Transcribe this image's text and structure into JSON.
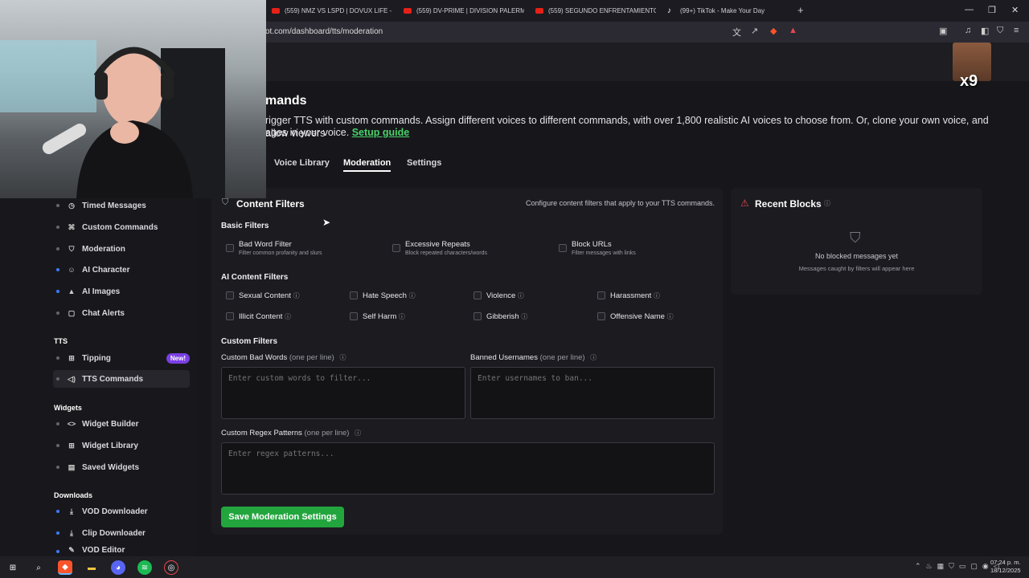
{
  "browser": {
    "tabs": [
      {
        "label": "(559) NMZ VS LSPD | DOVUX LIFE - Y",
        "kind": "youtube"
      },
      {
        "label": "(559) DV-PRIME | DIVISION PALERMO",
        "kind": "youtube"
      },
      {
        "label": "(559) SEGUNDO ENFRENTAMIENTO",
        "kind": "youtube"
      },
      {
        "label": "(99+) TikTok - Make Your Day",
        "kind": "tiktok"
      }
    ],
    "url": "ot.com/dashboard/tts/moderation"
  },
  "header": {
    "title": "mands",
    "description_line1": "rigger TTS with custom commands. Assign different voices to different commands, with over 1,800 realistic AI voices to choose from. Or, clone your own voice, and allow viewers",
    "description_line2": "ages in your voice.",
    "setup_guide": "Setup guide"
  },
  "page_tabs": [
    "Voice Library",
    "Moderation",
    "Settings"
  ],
  "sidebar": {
    "top_items": [
      {
        "label": "Timed Messages",
        "icon": "clock-icon",
        "dot": "gray"
      },
      {
        "label": "Custom Commands",
        "icon": "command-icon",
        "dot": "gray"
      },
      {
        "label": "Moderation",
        "icon": "shield-icon",
        "dot": "gray"
      },
      {
        "label": "AI Character",
        "icon": "user-icon",
        "dot": "blue"
      },
      {
        "label": "AI Images",
        "icon": "image-icon",
        "dot": "blue"
      },
      {
        "label": "Chat Alerts",
        "icon": "bell-icon",
        "dot": "gray"
      }
    ],
    "tts_section": "TTS",
    "tts_items": [
      {
        "label": "Tipping",
        "badge": "New!"
      },
      {
        "label": "TTS Commands"
      }
    ],
    "widgets_section": "Widgets",
    "widgets_items": [
      "Widget Builder",
      "Widget Library",
      "Saved Widgets"
    ],
    "downloads_section": "Downloads",
    "downloads_items": [
      "VOD Downloader",
      "Clip Downloader",
      "VOD Editor"
    ]
  },
  "content_filters": {
    "title": "Content Filters",
    "description": "Configure content filters that apply to your TTS commands.",
    "basic_title": "Basic Filters",
    "basic": [
      {
        "label": "Bad Word Filter",
        "hint": "Filter common profanity and slurs"
      },
      {
        "label": "Excessive Repeats",
        "hint": "Block repeated characters/words"
      },
      {
        "label": "Block URLs",
        "hint": "Filter messages with links"
      }
    ],
    "ai_title": "AI Content Filters",
    "ai": [
      "Sexual Content",
      "Hate Speech",
      "Violence",
      "Harassment",
      "Illicit Content",
      "Self Harm",
      "Gibberish",
      "Offensive Name"
    ],
    "custom_title": "Custom Filters",
    "bad_words_label": "Custom Bad Words",
    "bad_words_suffix": "(one per line)",
    "bad_words_placeholder": "Enter custom words to filter...",
    "banned_label": "Banned Usernames",
    "banned_suffix": "(one per line)",
    "banned_placeholder": "Enter usernames to ban...",
    "regex_label": "Custom Regex Patterns",
    "regex_suffix": "(one per line)",
    "regex_placeholder": "Enter regex patterns...",
    "save_label": "Save Moderation Settings"
  },
  "recent_blocks": {
    "title": "Recent Blocks",
    "empty_title": "No blocked messages yet",
    "empty_hint": "Messages caught by filters will appear here"
  },
  "overlay": {
    "emote_count": "x9"
  },
  "taskbar": {
    "time": "07:24 p. m.",
    "date": "18/12/2025"
  },
  "colors": {
    "accent_green": "#23a53e",
    "link_green": "#4ad36a",
    "badge_purple": "#7b3fe4",
    "alert_red": "#e5484d"
  }
}
